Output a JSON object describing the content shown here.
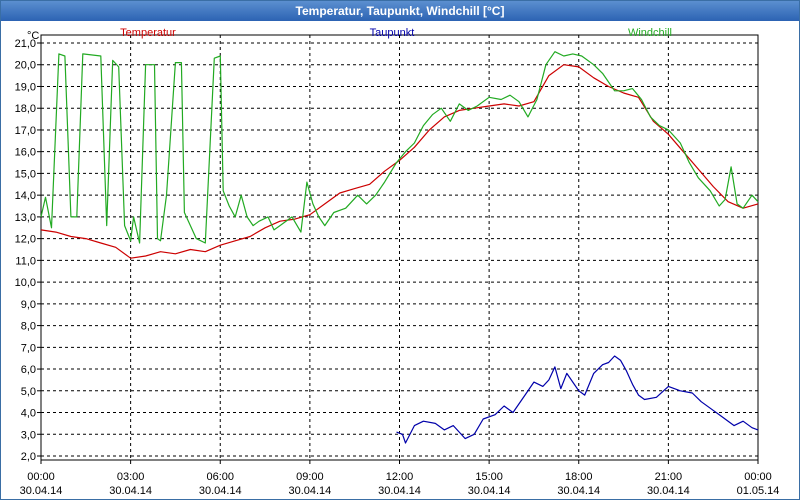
{
  "window": {
    "title": "Temperatur, Taupunkt, Windchill [°C]"
  },
  "chart_data": {
    "type": "line",
    "y_unit": "°C",
    "ylim": [
      2.0,
      21.0
    ],
    "y_ticks": [
      "2,0",
      "3,0",
      "4,0",
      "5,0",
      "6,0",
      "7,0",
      "8,0",
      "9,0",
      "10,0",
      "11,0",
      "12,0",
      "13,0",
      "14,0",
      "15,0",
      "16,0",
      "17,0",
      "18,0",
      "19,0",
      "20,0",
      "21,0"
    ],
    "x_range_hours": [
      0,
      24
    ],
    "x_ticks": [
      {
        "time": "00:00",
        "date": "30.04.14"
      },
      {
        "time": "03:00",
        "date": "30.04.14"
      },
      {
        "time": "06:00",
        "date": "30.04.14"
      },
      {
        "time": "09:00",
        "date": "30.04.14"
      },
      {
        "time": "12:00",
        "date": "30.04.14"
      },
      {
        "time": "15:00",
        "date": "30.04.14"
      },
      {
        "time": "18:00",
        "date": "30.04.14"
      },
      {
        "time": "21:00",
        "date": "30.04.14"
      },
      {
        "time": "00:00",
        "date": "01.05.14"
      }
    ],
    "grid": true,
    "series": [
      {
        "name": "Temperatur",
        "color": "#cc0000",
        "legend_pos": "left",
        "points": [
          [
            0,
            12.4
          ],
          [
            0.5,
            12.3
          ],
          [
            1,
            12.1
          ],
          [
            1.5,
            12.0
          ],
          [
            2,
            11.8
          ],
          [
            2.5,
            11.6
          ],
          [
            3,
            11.1
          ],
          [
            3.5,
            11.2
          ],
          [
            4,
            11.4
          ],
          [
            4.5,
            11.3
          ],
          [
            5,
            11.5
          ],
          [
            5.5,
            11.4
          ],
          [
            6,
            11.7
          ],
          [
            6.5,
            11.9
          ],
          [
            7,
            12.1
          ],
          [
            7.5,
            12.5
          ],
          [
            8,
            12.8
          ],
          [
            8.5,
            12.9
          ],
          [
            9,
            13.1
          ],
          [
            9.5,
            13.6
          ],
          [
            10,
            14.1
          ],
          [
            10.5,
            14.3
          ],
          [
            11,
            14.5
          ],
          [
            11.5,
            15.1
          ],
          [
            12,
            15.6
          ],
          [
            12.5,
            16.2
          ],
          [
            13,
            17.0
          ],
          [
            13.5,
            17.6
          ],
          [
            14,
            17.9
          ],
          [
            14.5,
            18.0
          ],
          [
            15,
            18.1
          ],
          [
            15.5,
            18.2
          ],
          [
            16,
            18.1
          ],
          [
            16.5,
            18.3
          ],
          [
            17,
            19.5
          ],
          [
            17.5,
            20.0
          ],
          [
            18,
            19.9
          ],
          [
            18.5,
            19.4
          ],
          [
            19,
            19.0
          ],
          [
            19.5,
            18.7
          ],
          [
            20,
            18.5
          ],
          [
            20.5,
            17.4
          ],
          [
            21,
            16.8
          ],
          [
            21.5,
            16.0
          ],
          [
            22,
            15.2
          ],
          [
            22.5,
            14.4
          ],
          [
            23,
            13.7
          ],
          [
            23.5,
            13.4
          ],
          [
            24,
            13.6
          ]
        ]
      },
      {
        "name": "Taupunkt",
        "color": "#0000aa",
        "legend_pos": "center",
        "points": [
          [
            11.9,
            3.1
          ],
          [
            12.1,
            3.0
          ],
          [
            12.2,
            2.6
          ],
          [
            12.5,
            3.4
          ],
          [
            12.8,
            3.6
          ],
          [
            13.2,
            3.5
          ],
          [
            13.5,
            3.2
          ],
          [
            13.8,
            3.4
          ],
          [
            14.2,
            2.8
          ],
          [
            14.5,
            3.0
          ],
          [
            14.8,
            3.7
          ],
          [
            15.2,
            3.9
          ],
          [
            15.5,
            4.3
          ],
          [
            15.8,
            4.0
          ],
          [
            16.2,
            4.8
          ],
          [
            16.5,
            5.4
          ],
          [
            16.8,
            5.2
          ],
          [
            17.0,
            5.5
          ],
          [
            17.2,
            6.1
          ],
          [
            17.4,
            5.1
          ],
          [
            17.6,
            5.8
          ],
          [
            17.8,
            5.4
          ],
          [
            18.0,
            5.0
          ],
          [
            18.2,
            4.8
          ],
          [
            18.5,
            5.8
          ],
          [
            18.8,
            6.2
          ],
          [
            19.0,
            6.3
          ],
          [
            19.2,
            6.6
          ],
          [
            19.4,
            6.4
          ],
          [
            19.6,
            5.9
          ],
          [
            19.8,
            5.3
          ],
          [
            20.0,
            4.8
          ],
          [
            20.2,
            4.6
          ],
          [
            20.6,
            4.7
          ],
          [
            21.0,
            5.2
          ],
          [
            21.4,
            5.0
          ],
          [
            21.8,
            4.9
          ],
          [
            22.1,
            4.5
          ],
          [
            22.4,
            4.2
          ],
          [
            22.8,
            3.8
          ],
          [
            23.2,
            3.4
          ],
          [
            23.5,
            3.6
          ],
          [
            23.8,
            3.3
          ],
          [
            24.0,
            3.2
          ]
        ]
      },
      {
        "name": "Windchill",
        "color": "#22aa22",
        "legend_pos": "right",
        "points": [
          [
            0,
            13.0
          ],
          [
            0.15,
            13.9
          ],
          [
            0.35,
            12.5
          ],
          [
            0.6,
            20.5
          ],
          [
            0.8,
            20.4
          ],
          [
            1.0,
            13.0
          ],
          [
            1.2,
            13.0
          ],
          [
            1.4,
            20.5
          ],
          [
            2.0,
            20.4
          ],
          [
            2.2,
            12.6
          ],
          [
            2.4,
            20.2
          ],
          [
            2.6,
            19.9
          ],
          [
            2.8,
            12.6
          ],
          [
            3.0,
            11.9
          ],
          [
            3.1,
            13.0
          ],
          [
            3.3,
            11.8
          ],
          [
            3.5,
            20.0
          ],
          [
            3.8,
            20.0
          ],
          [
            3.9,
            12.0
          ],
          [
            4.0,
            11.9
          ],
          [
            4.2,
            14.0
          ],
          [
            4.5,
            20.1
          ],
          [
            4.7,
            20.1
          ],
          [
            4.8,
            13.2
          ],
          [
            5.2,
            12.0
          ],
          [
            5.5,
            11.8
          ],
          [
            5.8,
            20.3
          ],
          [
            6.0,
            20.4
          ],
          [
            6.1,
            14.2
          ],
          [
            6.3,
            13.5
          ],
          [
            6.5,
            13.0
          ],
          [
            6.7,
            14.0
          ],
          [
            6.9,
            13.0
          ],
          [
            7.1,
            12.6
          ],
          [
            7.3,
            12.8
          ],
          [
            7.6,
            13.0
          ],
          [
            7.8,
            12.4
          ],
          [
            8.0,
            12.6
          ],
          [
            8.4,
            13.0
          ],
          [
            8.7,
            12.3
          ],
          [
            8.9,
            14.6
          ],
          [
            9.1,
            13.6
          ],
          [
            9.3,
            13.0
          ],
          [
            9.5,
            12.6
          ],
          [
            9.8,
            13.2
          ],
          [
            10.2,
            13.4
          ],
          [
            10.6,
            14.0
          ],
          [
            10.9,
            13.6
          ],
          [
            11.2,
            14.0
          ],
          [
            11.5,
            14.6
          ],
          [
            11.9,
            15.5
          ],
          [
            12.2,
            16.0
          ],
          [
            12.5,
            16.4
          ],
          [
            12.8,
            17.2
          ],
          [
            13.1,
            17.7
          ],
          [
            13.4,
            18.0
          ],
          [
            13.7,
            17.4
          ],
          [
            14.0,
            18.2
          ],
          [
            14.3,
            17.9
          ],
          [
            14.6,
            18.1
          ],
          [
            15.0,
            18.5
          ],
          [
            15.4,
            18.4
          ],
          [
            15.7,
            18.6
          ],
          [
            16.0,
            18.3
          ],
          [
            16.3,
            17.6
          ],
          [
            16.6,
            18.4
          ],
          [
            16.9,
            20.0
          ],
          [
            17.2,
            20.6
          ],
          [
            17.5,
            20.4
          ],
          [
            17.8,
            20.5
          ],
          [
            18.1,
            20.4
          ],
          [
            18.5,
            20.0
          ],
          [
            18.8,
            19.6
          ],
          [
            19.2,
            18.8
          ],
          [
            19.5,
            18.8
          ],
          [
            19.8,
            18.9
          ],
          [
            20.1,
            18.4
          ],
          [
            20.4,
            17.6
          ],
          [
            20.7,
            17.2
          ],
          [
            21.0,
            17.0
          ],
          [
            21.4,
            16.4
          ],
          [
            21.7,
            15.5
          ],
          [
            22.0,
            14.8
          ],
          [
            22.4,
            14.2
          ],
          [
            22.7,
            13.5
          ],
          [
            22.9,
            13.8
          ],
          [
            23.1,
            15.3
          ],
          [
            23.3,
            13.6
          ],
          [
            23.5,
            13.4
          ],
          [
            23.8,
            14.0
          ],
          [
            24.0,
            13.7
          ]
        ]
      }
    ]
  }
}
